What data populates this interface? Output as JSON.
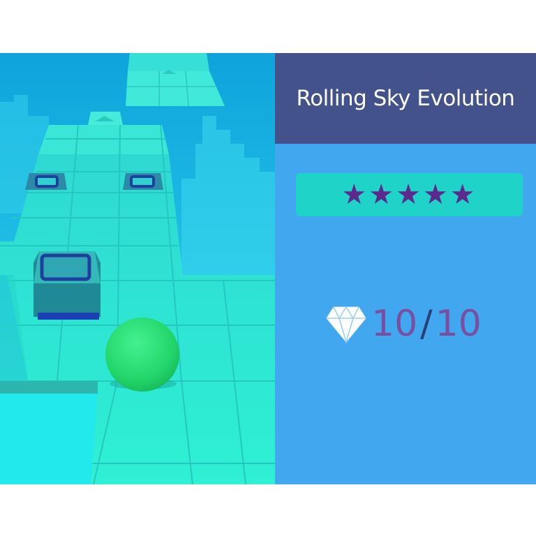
{
  "panel": {
    "title": "Rolling Sky Evolution",
    "rating": {
      "stars": "★★★★★",
      "value": 5,
      "max": 5
    },
    "gems": {
      "icon": "diamond-icon",
      "collected": "10",
      "separator": "/",
      "total": "10"
    }
  },
  "scene": {
    "player": "green-ball",
    "colors": {
      "sky": "#1ab6e2",
      "track": "#2ee8cf",
      "ball": "#28e07a",
      "panel_header": "#44528c",
      "panel_body": "#41a7ee",
      "rating_box": "#20d3c8",
      "star": "#5b2a8c",
      "score": "#7a4ea0"
    }
  }
}
